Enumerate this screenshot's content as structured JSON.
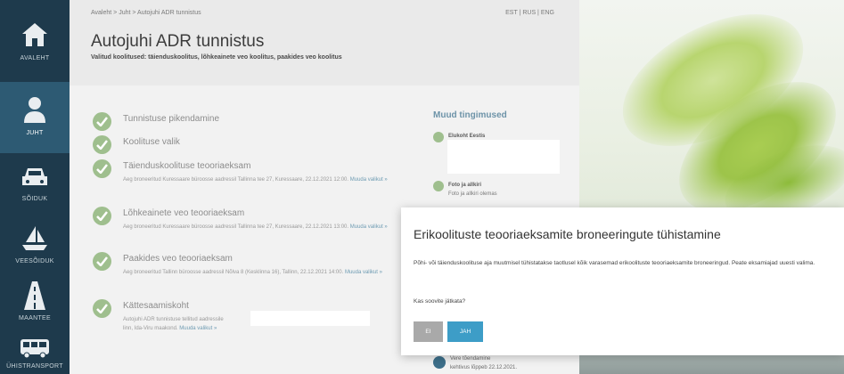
{
  "sidebar": {
    "items": [
      {
        "label": "AVALEHT",
        "icon": "home-icon",
        "active": false
      },
      {
        "label": "JUHT",
        "icon": "person-icon",
        "active": true
      },
      {
        "label": "SÕIDUK",
        "icon": "car-icon",
        "active": false
      },
      {
        "label": "VEESÕIDUK",
        "icon": "boat-icon",
        "active": false
      },
      {
        "label": "MAANTEE",
        "icon": "road-icon",
        "active": false
      },
      {
        "label": "ÜHISTRANSPORT",
        "icon": "bus-icon",
        "active": false
      }
    ]
  },
  "header": {
    "breadcrumb": "Avaleht > Juht > Autojuhi ADR tunnistus",
    "languages": "EST | RUS | ENG",
    "title": "Autojuhi ADR tunnistus",
    "subtitle": "Valitud koolitused: täienduskoolitus, lõhkeainete veo koolitus, paakides veo koolitus"
  },
  "steps": [
    {
      "title": "Tunnistuse pikendamine",
      "detail": "",
      "link": ""
    },
    {
      "title": "Koolituse valik",
      "detail": "",
      "link": ""
    },
    {
      "title": "Täienduskoolituse teooriaeksam",
      "detail": "Aeg broneeritud Kuressaare büroosse aadressil Tallinna tee 27, Kuressaare, 22.12.2021 12:00.",
      "link": "Muuda valikut »"
    },
    {
      "title": "Lõhkeainete veo teooriaeksam",
      "detail": "Aeg broneeritud Kuressaare büroosse aadressil Tallinna tee 27, Kuressaare, 22.12.2021 13:00.",
      "link": "Muuda valikut »"
    },
    {
      "title": "Paakides veo teooriaeksam",
      "detail": "Aeg broneeritud Tallinn büroosse aadressil Nõlva 8 (Kesklinna 16), Tallinn, 22.12.2021 14:00.",
      "link": "Muuda valikut »"
    },
    {
      "title": "Kättesaamiskoht",
      "detail": "Autojuhi ADR tunnistuse tellitud aadressile",
      "detail2": "linn, Ida-Viru maakond.",
      "link": "Muuda valikut »"
    }
  ],
  "other_conditions": {
    "title": "Muud tingimused",
    "items": [
      {
        "label": "Elukoht Eestis",
        "sub": ""
      },
      {
        "label": "Foto ja allkiri",
        "sub": "Foto ja allkiri olemas"
      }
    ],
    "bottom_note_1": "Vere tõendamine",
    "bottom_note_2": "kehtivus lõppeb 22.12.2021."
  },
  "modal": {
    "title": "Erikoolituste teooriaeksamite broneeringute tühistamine",
    "text": "Põhi- või täienduskoolituse aja muutmisel tühistatakse taotlusel kõik varasemad erikoolituste teooriaeksamite broneeringud. Peate eksamiajad uuesti valima.",
    "question": "Kas soovite jätkata?",
    "no_label": "EI",
    "yes_label": "JAH"
  },
  "colors": {
    "sidebar": "#1e3a4c",
    "sidebar_active": "#2d5a73",
    "check": "#9fbf8e",
    "yes_button": "#3d9dc7",
    "no_button": "#a9a9a9"
  }
}
